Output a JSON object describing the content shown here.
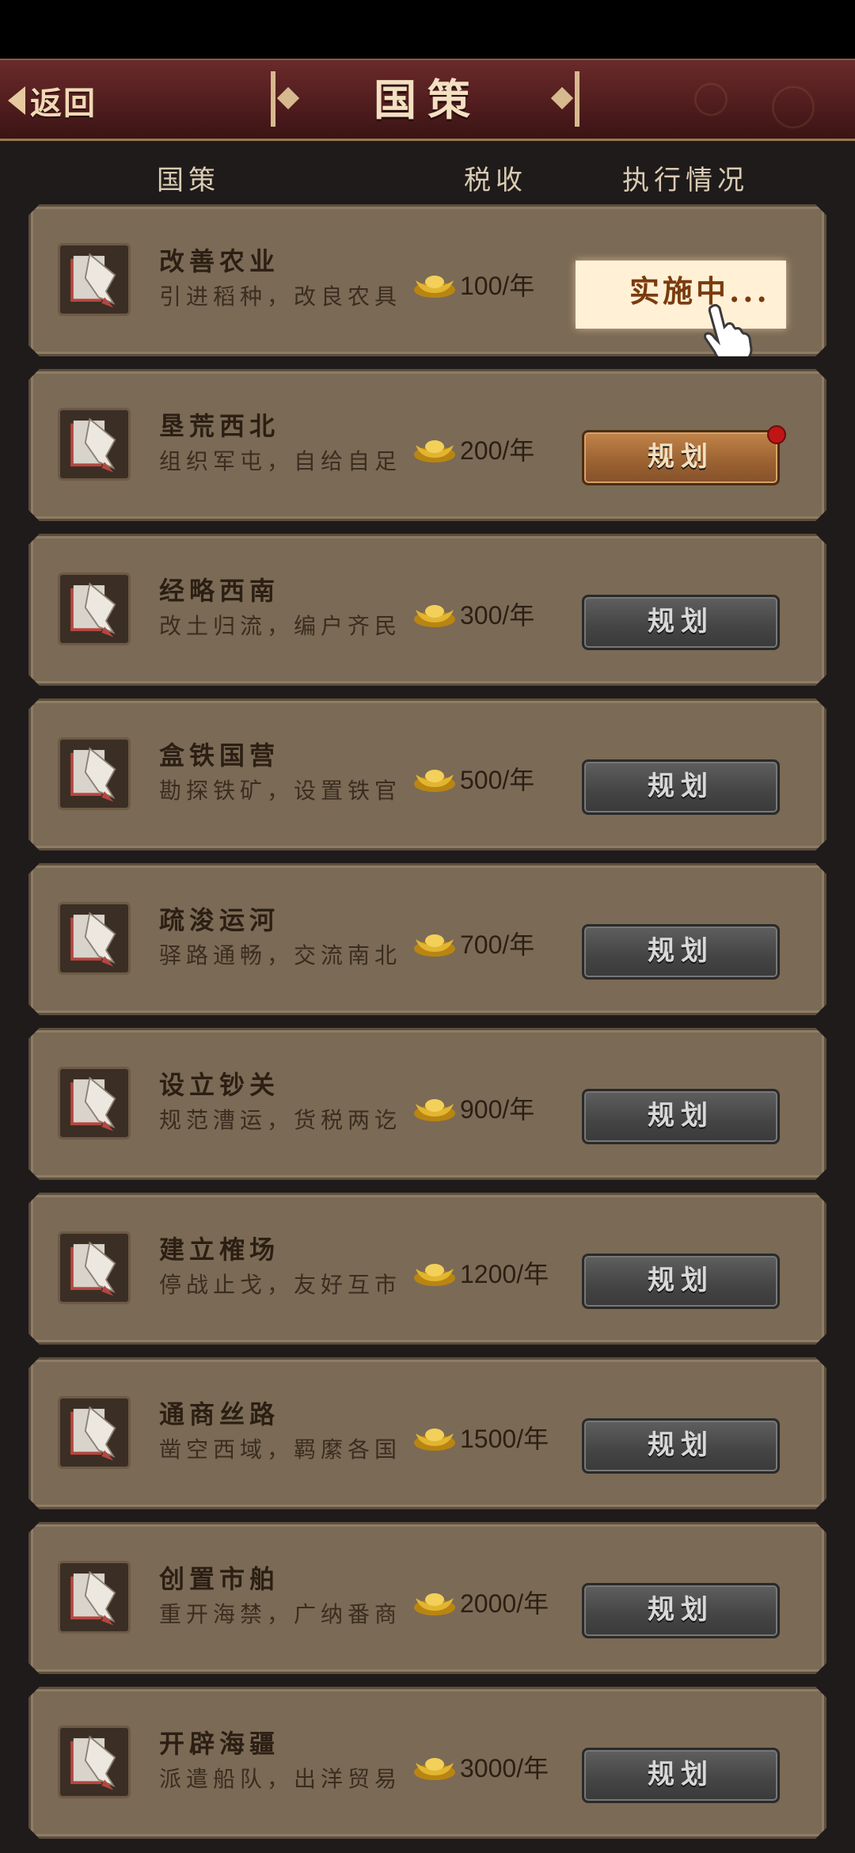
{
  "header": {
    "back_label": "返回",
    "title": "国策"
  },
  "columns": {
    "name": "国策",
    "tax": "税收",
    "status": "执行情况"
  },
  "policies": [
    {
      "name": "改善农业",
      "desc": "引进稻种，改良农具",
      "tax": "100/年",
      "status": "实施中..."
    },
    {
      "name": "垦荒西北",
      "desc": "组织军屯，自给自足",
      "tax": "200/年",
      "action": "规划"
    },
    {
      "name": "经略西南",
      "desc": "改土归流，编户齐民",
      "tax": "300/年",
      "action": "规划"
    },
    {
      "name": "盒铁国营",
      "desc": "勘探铁矿，设置铁官",
      "tax": "500/年",
      "action": "规划"
    },
    {
      "name": "疏浚运河",
      "desc": "驿路通畅，交流南北",
      "tax": "700/年",
      "action": "规划"
    },
    {
      "name": "设立钞关",
      "desc": "规范漕运，货税两讫",
      "tax": "900/年",
      "action": "规划"
    },
    {
      "name": "建立榷场",
      "desc": "停战止戈，友好互市",
      "tax": "1200/年",
      "action": "规划"
    },
    {
      "name": "通商丝路",
      "desc": "凿空西域，羁縻各国",
      "tax": "1500/年",
      "action": "规划"
    },
    {
      "name": "创置市舶",
      "desc": "重开海禁，广纳番商",
      "tax": "2000/年",
      "action": "规划"
    },
    {
      "name": "开辟海疆",
      "desc": "派遣船队，出洋贸易",
      "tax": "3000/年",
      "action": "规划"
    }
  ],
  "colors": {
    "header_bg": "#5a2122",
    "card_bg": "#7b6a55",
    "active_button": "#a7693a",
    "disabled_button": "#4a4a4a",
    "badge": "#c01515"
  },
  "icons": {
    "policy": "book-scroll-icon",
    "tax": "gold-ingot-icon",
    "pointer": "hand-pointer-icon",
    "back": "back-arrow-icon"
  }
}
